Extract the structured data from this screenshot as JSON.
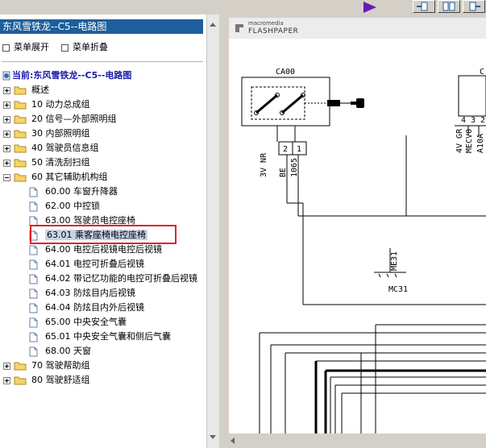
{
  "left_panel": {
    "title": "东风雪铁龙--C5--电路图",
    "menu": {
      "expand_label": "菜单展开",
      "collapse_label": "菜单折叠"
    },
    "tree_root_label": "当前:东风雪铁龙--C5--电路图",
    "tree": [
      {
        "label": "概述",
        "kind": "folder",
        "expanded": false
      },
      {
        "label": "10 动力总成组",
        "kind": "folder",
        "expanded": false
      },
      {
        "label": "20 信号—外部照明组",
        "kind": "folder",
        "expanded": false
      },
      {
        "label": "30 内部照明组",
        "kind": "folder",
        "expanded": false
      },
      {
        "label": "40 驾驶员信息组",
        "kind": "folder",
        "expanded": false
      },
      {
        "label": "50 清洗刮扫组",
        "kind": "folder",
        "expanded": false
      },
      {
        "label": "60 其它辅助机构组",
        "kind": "folder",
        "expanded": true
      },
      {
        "label": "60.00 车窗升降器",
        "kind": "page"
      },
      {
        "label": "62.00 中控锁",
        "kind": "page"
      },
      {
        "label": "63.00 驾驶员电控座椅",
        "kind": "page"
      },
      {
        "label": "63.01 乘客座椅电控座椅",
        "kind": "page",
        "selected": true
      },
      {
        "label": "64.00 电控后视镜电控后视镜",
        "kind": "page"
      },
      {
        "label": "64.01 电控可折叠后视镜",
        "kind": "page"
      },
      {
        "label": "64.02 带记忆功能的电控可折叠后视镜",
        "kind": "page"
      },
      {
        "label": "64.03 防炫目内后视镜",
        "kind": "page"
      },
      {
        "label": "64.04 防炫目内外后视镜",
        "kind": "page"
      },
      {
        "label": "65.00 中央安全气囊",
        "kind": "page"
      },
      {
        "label": "65.01 中央安全气囊和侧后气囊",
        "kind": "page"
      },
      {
        "label": "68.00 天窗",
        "kind": "page"
      },
      {
        "label": "70 驾驶帮助组",
        "kind": "folder",
        "expanded": false
      },
      {
        "label": "80 驾驶舒适组",
        "kind": "folder",
        "expanded": false
      }
    ]
  },
  "viewer": {
    "logo_small": "macromedia",
    "logo_big": "FLASHPAPER",
    "diagram": {
      "component_ca00": "CA00",
      "component_c_partial": "C",
      "conn_pin_2": "2",
      "conn_pin_1": "1",
      "wire_label_3v_nr": "3V NR",
      "wire_label_be": "BE",
      "wire_label_1065": "1065",
      "right_label_4v_gr": "4V GR",
      "right_label_mecv0": "MECV0",
      "right_label_a10a": "A10A",
      "right_pins": [
        "4",
        "3",
        "2"
      ],
      "ground_label_me31": "ME31",
      "ground_label_mc31": "MC31"
    }
  },
  "colors": {
    "title_bar": "#1c5f9b",
    "tree_root": "#1a1aa8",
    "highlight_border": "#e02424",
    "toolbar_accent": "#6a1ab0",
    "selection_bg": "#c8d2e6"
  }
}
